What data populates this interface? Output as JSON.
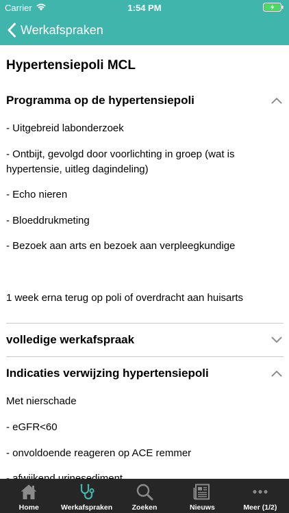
{
  "status_bar": {
    "carrier": "Carrier",
    "time": "1:54 PM"
  },
  "nav": {
    "back_label": "Werkafspraken"
  },
  "page_title": "Hypertensiepoli MCL",
  "sections": [
    {
      "title": "Programma op de hypertensiepoli",
      "expanded": true,
      "paragraphs": [
        "- Uitgebreid labonderzoek",
        "- Ontbijt, gevolgd door voorlichting in groep (wat is hypertensie, uitleg dagindeling)",
        "- Echo nieren",
        "- Bloeddrukmeting",
        "- Bezoek aan arts en bezoek aan verpleegkundige",
        "1 week erna terug op poli of overdracht aan huisarts"
      ]
    },
    {
      "title": "volledige werkafspraak",
      "expanded": false
    },
    {
      "title": "Indicaties verwijzing hypertensiepoli",
      "expanded": true,
      "paragraphs": [
        "Met nierschade",
        "- eGFR<60",
        "- onvoldoende reageren op ACE remmer",
        "- afwijkend urinesediment"
      ]
    }
  ],
  "tabbar": {
    "tabs": [
      {
        "label": "Home",
        "icon": "home-icon"
      },
      {
        "label": "Werkafspraken",
        "icon": "stethoscope-icon",
        "active": true
      },
      {
        "label": "Zoeken",
        "icon": "search-icon"
      },
      {
        "label": "Nieuws",
        "icon": "newspaper-icon"
      },
      {
        "label": "Meer (1/2)",
        "icon": "more-icon"
      }
    ]
  },
  "colors": {
    "header": "#3fb5ab",
    "tab_active": "#3fb5ab",
    "tab_inactive": "#8a8a8a",
    "tabbar_bg": "#262626"
  }
}
